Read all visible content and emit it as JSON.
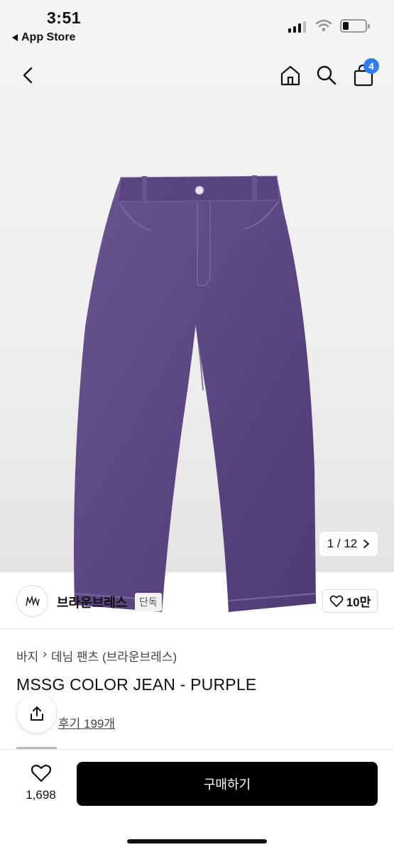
{
  "status_bar": {
    "time": "3:51",
    "back_label": "App Store"
  },
  "header": {
    "cart_count": "4"
  },
  "gallery": {
    "current": "1",
    "total": "12",
    "counter_text": "1 / 12",
    "product_color": "#5e4784"
  },
  "brand": {
    "name": "브라운브레스",
    "tag": "단독",
    "like_count": "10만"
  },
  "breadcrumb": {
    "category": "바지",
    "subcategory": "데님 팬츠 (브라운브레스)"
  },
  "product": {
    "title": "MSSG COLOR JEAN - PURPLE",
    "review_text": "후기 199개"
  },
  "bottom_bar": {
    "wish_count": "1,698",
    "buy_label": "구매하기"
  },
  "colors": {
    "accent_badge": "#2f7df6",
    "buy_button": "#000000"
  }
}
